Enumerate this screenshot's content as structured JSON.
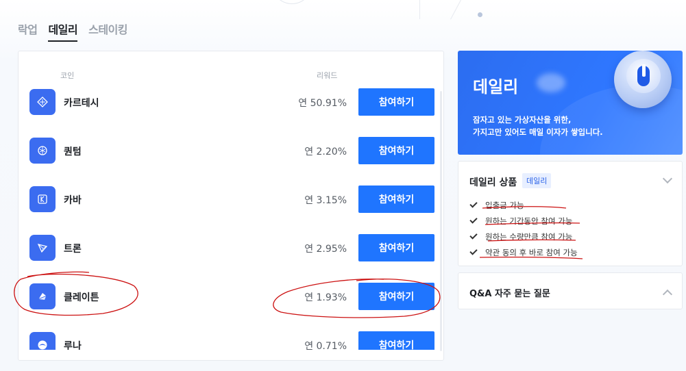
{
  "tabs": [
    {
      "label": "락업",
      "active": false
    },
    {
      "label": "데일리",
      "active": true
    },
    {
      "label": "스테이킹",
      "active": false
    }
  ],
  "list": {
    "header_coin": "코인",
    "header_reward": "리워드",
    "rows": [
      {
        "name": "카르테시",
        "rate": "연 50.91%",
        "button": "참여하기",
        "icon": "cartesi-icon"
      },
      {
        "name": "퀀텀",
        "rate": "연 2.20%",
        "button": "참여하기",
        "icon": "qtum-icon"
      },
      {
        "name": "카바",
        "rate": "연 3.15%",
        "button": "참여하기",
        "icon": "kava-icon"
      },
      {
        "name": "트론",
        "rate": "연 2.95%",
        "button": "참여하기",
        "icon": "tron-icon"
      },
      {
        "name": "클레이튼",
        "rate": "연 1.93%",
        "button": "참여하기",
        "icon": "klaytn-icon"
      },
      {
        "name": "루나",
        "rate": "연 0.71%",
        "button": "참여하기",
        "icon": "luna-icon"
      }
    ]
  },
  "promo": {
    "title": "데일리",
    "desc_line1": "잠자고 있는 가상자산을 위한,",
    "desc_line2": "가지고만 있어도 매일 이자가 쌓입니다."
  },
  "product": {
    "title": "데일리 상품",
    "badge": "데일리",
    "features": [
      "입출금 가능",
      "원하는 기간동안 참여 가능",
      "원하는 수량만큼 참여 가능",
      "약관 동의 후 바로 참여 가능"
    ]
  },
  "faq": {
    "title": "Q&A 자주 묻는 질문"
  },
  "colors": {
    "accent": "#1f75ff",
    "annotation": "#cc1111"
  }
}
